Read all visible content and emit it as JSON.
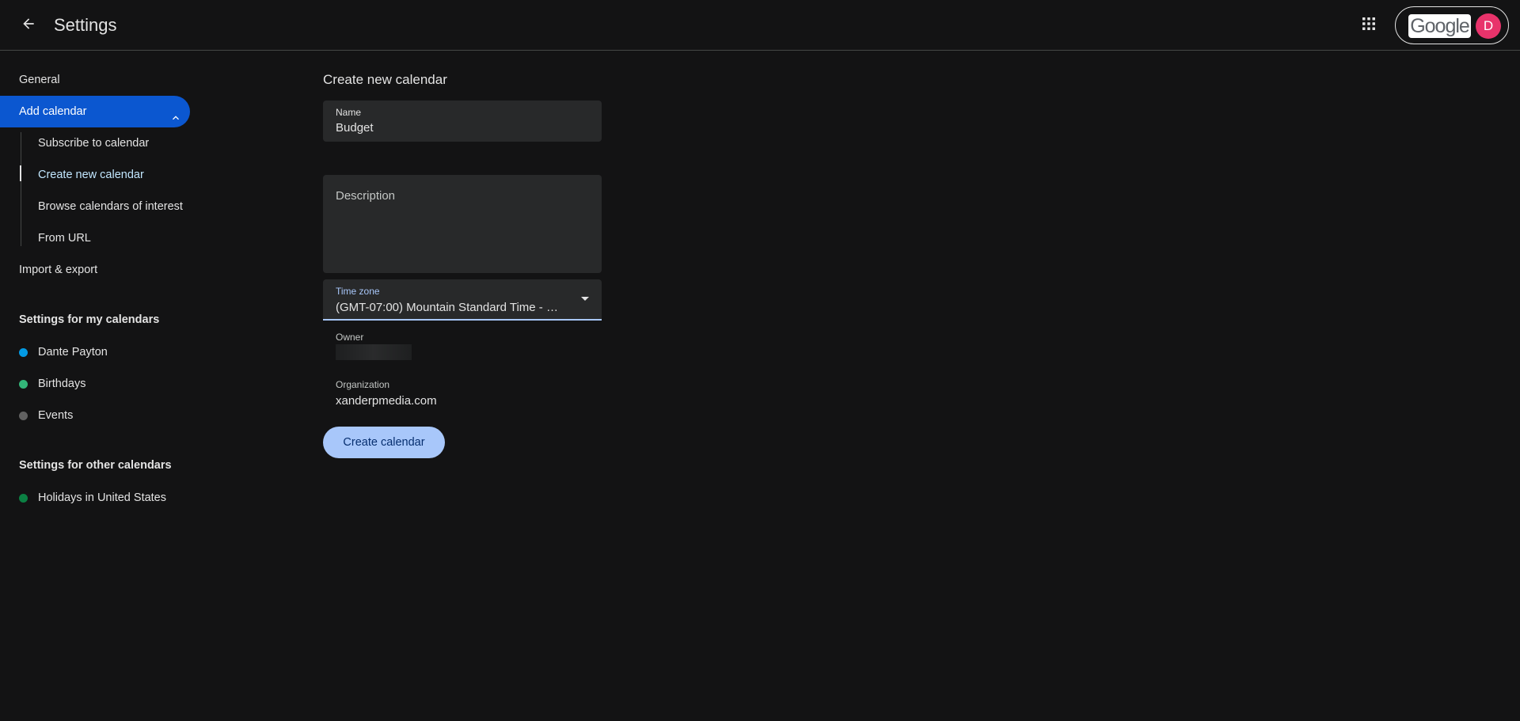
{
  "header": {
    "back_icon": "arrow-back-icon",
    "title": "Settings",
    "apps_icon": "apps-grid-icon",
    "account": {
      "logo_text": "Google",
      "avatar_letter": "D"
    }
  },
  "sidebar": {
    "general": "General",
    "add_calendar": "Add calendar",
    "add_calendar_sub": [
      {
        "label": "Subscribe to calendar"
      },
      {
        "label": "Create new calendar",
        "selected": true
      },
      {
        "label": "Browse calendars of interest"
      },
      {
        "label": "From URL"
      }
    ],
    "import_export": "Import & export",
    "my_calendars_heading": "Settings for my calendars",
    "my_calendars": [
      {
        "label": "Dante Payton",
        "color": "#039be5"
      },
      {
        "label": "Birthdays",
        "color": "#33b679"
      },
      {
        "label": "Events",
        "color": "#616161"
      }
    ],
    "other_calendars_heading": "Settings for other calendars",
    "other_calendars": [
      {
        "label": "Holidays in United States",
        "color": "#0b8043"
      }
    ]
  },
  "main": {
    "title": "Create new calendar",
    "name": {
      "label": "Name",
      "value": "Budget"
    },
    "description": {
      "placeholder": "Description"
    },
    "time_zone": {
      "label": "Time zone",
      "value": "(GMT-07:00) Mountain Standard Time - Ph..."
    },
    "owner": {
      "label": "Owner"
    },
    "organization": {
      "label": "Organization",
      "value": "xanderpmedia.com"
    },
    "create_button": "Create calendar"
  },
  "colors": {
    "accent": "#0b57d0",
    "button_bg": "#a8c7fa",
    "background": "#131314"
  }
}
